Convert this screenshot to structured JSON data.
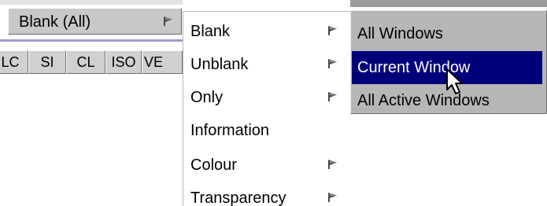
{
  "toolbar": {
    "dropdown_label": "Blank (All)",
    "buttons": [
      "LC",
      "SI",
      "CL",
      "ISO",
      "VE"
    ]
  },
  "menu": {
    "items": [
      {
        "label": "Blank",
        "has_submenu": true
      },
      {
        "label": "Unblank",
        "has_submenu": true
      },
      {
        "label": "Only",
        "has_submenu": true
      },
      {
        "label": "Information",
        "has_submenu": false
      },
      {
        "label": "Colour",
        "has_submenu": true
      },
      {
        "label": "Transparency",
        "has_submenu": true
      }
    ]
  },
  "submenu": {
    "items": [
      {
        "label": "All Windows",
        "highlighted": false
      },
      {
        "label": "Current Window",
        "highlighted": true
      },
      {
        "label": "All Active Windows",
        "highlighted": false
      }
    ]
  },
  "icons": {
    "submenu_arrow": "flag-arrow-icon",
    "cursor": "mouse-pointer-icon"
  },
  "colors": {
    "highlight": "#00007a",
    "submenu_bg": "#b6b6b6",
    "accent_line": "#9c9ccc"
  }
}
